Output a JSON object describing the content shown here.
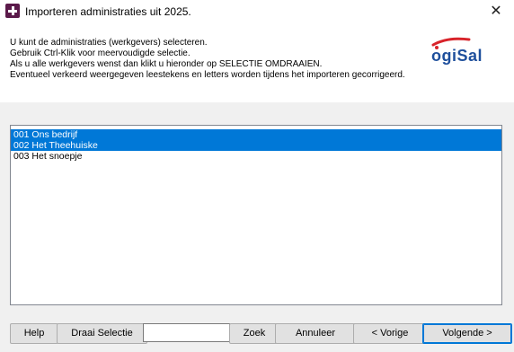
{
  "window": {
    "title": "Importeren administraties uit 2025.",
    "close_glyph": "✕"
  },
  "instructions": [
    "U kunt de administraties (werkgevers) selecteren.",
    "Gebruik Ctrl-Klik voor meervoudigde selectie.",
    "Als u alle werkgevers wenst dan klikt u hieronder op SELECTIE OMDRAAIEN.",
    "Eventueel verkeerd weergegeven leestekens en letters worden tijdens het importeren gecorrigeerd."
  ],
  "logo": {
    "text": "ogiSal",
    "color": "#1e4f9c",
    "accent": "#d8232a"
  },
  "list": {
    "items": [
      {
        "label": "001 Ons bedrijf",
        "selected": true
      },
      {
        "label": "002 Het Theehuiske",
        "selected": true
      },
      {
        "label": "003 Het snoepje",
        "selected": false
      }
    ]
  },
  "buttons": {
    "help": "Help",
    "invert": "Draai Selectie",
    "search": "Zoek",
    "cancel": "Annuleer",
    "previous": "< Vorige",
    "next": "Volgende >"
  },
  "search": {
    "value": ""
  },
  "colors": {
    "selection": "#0078d7",
    "dialog_bg": "#f0f0f0"
  }
}
